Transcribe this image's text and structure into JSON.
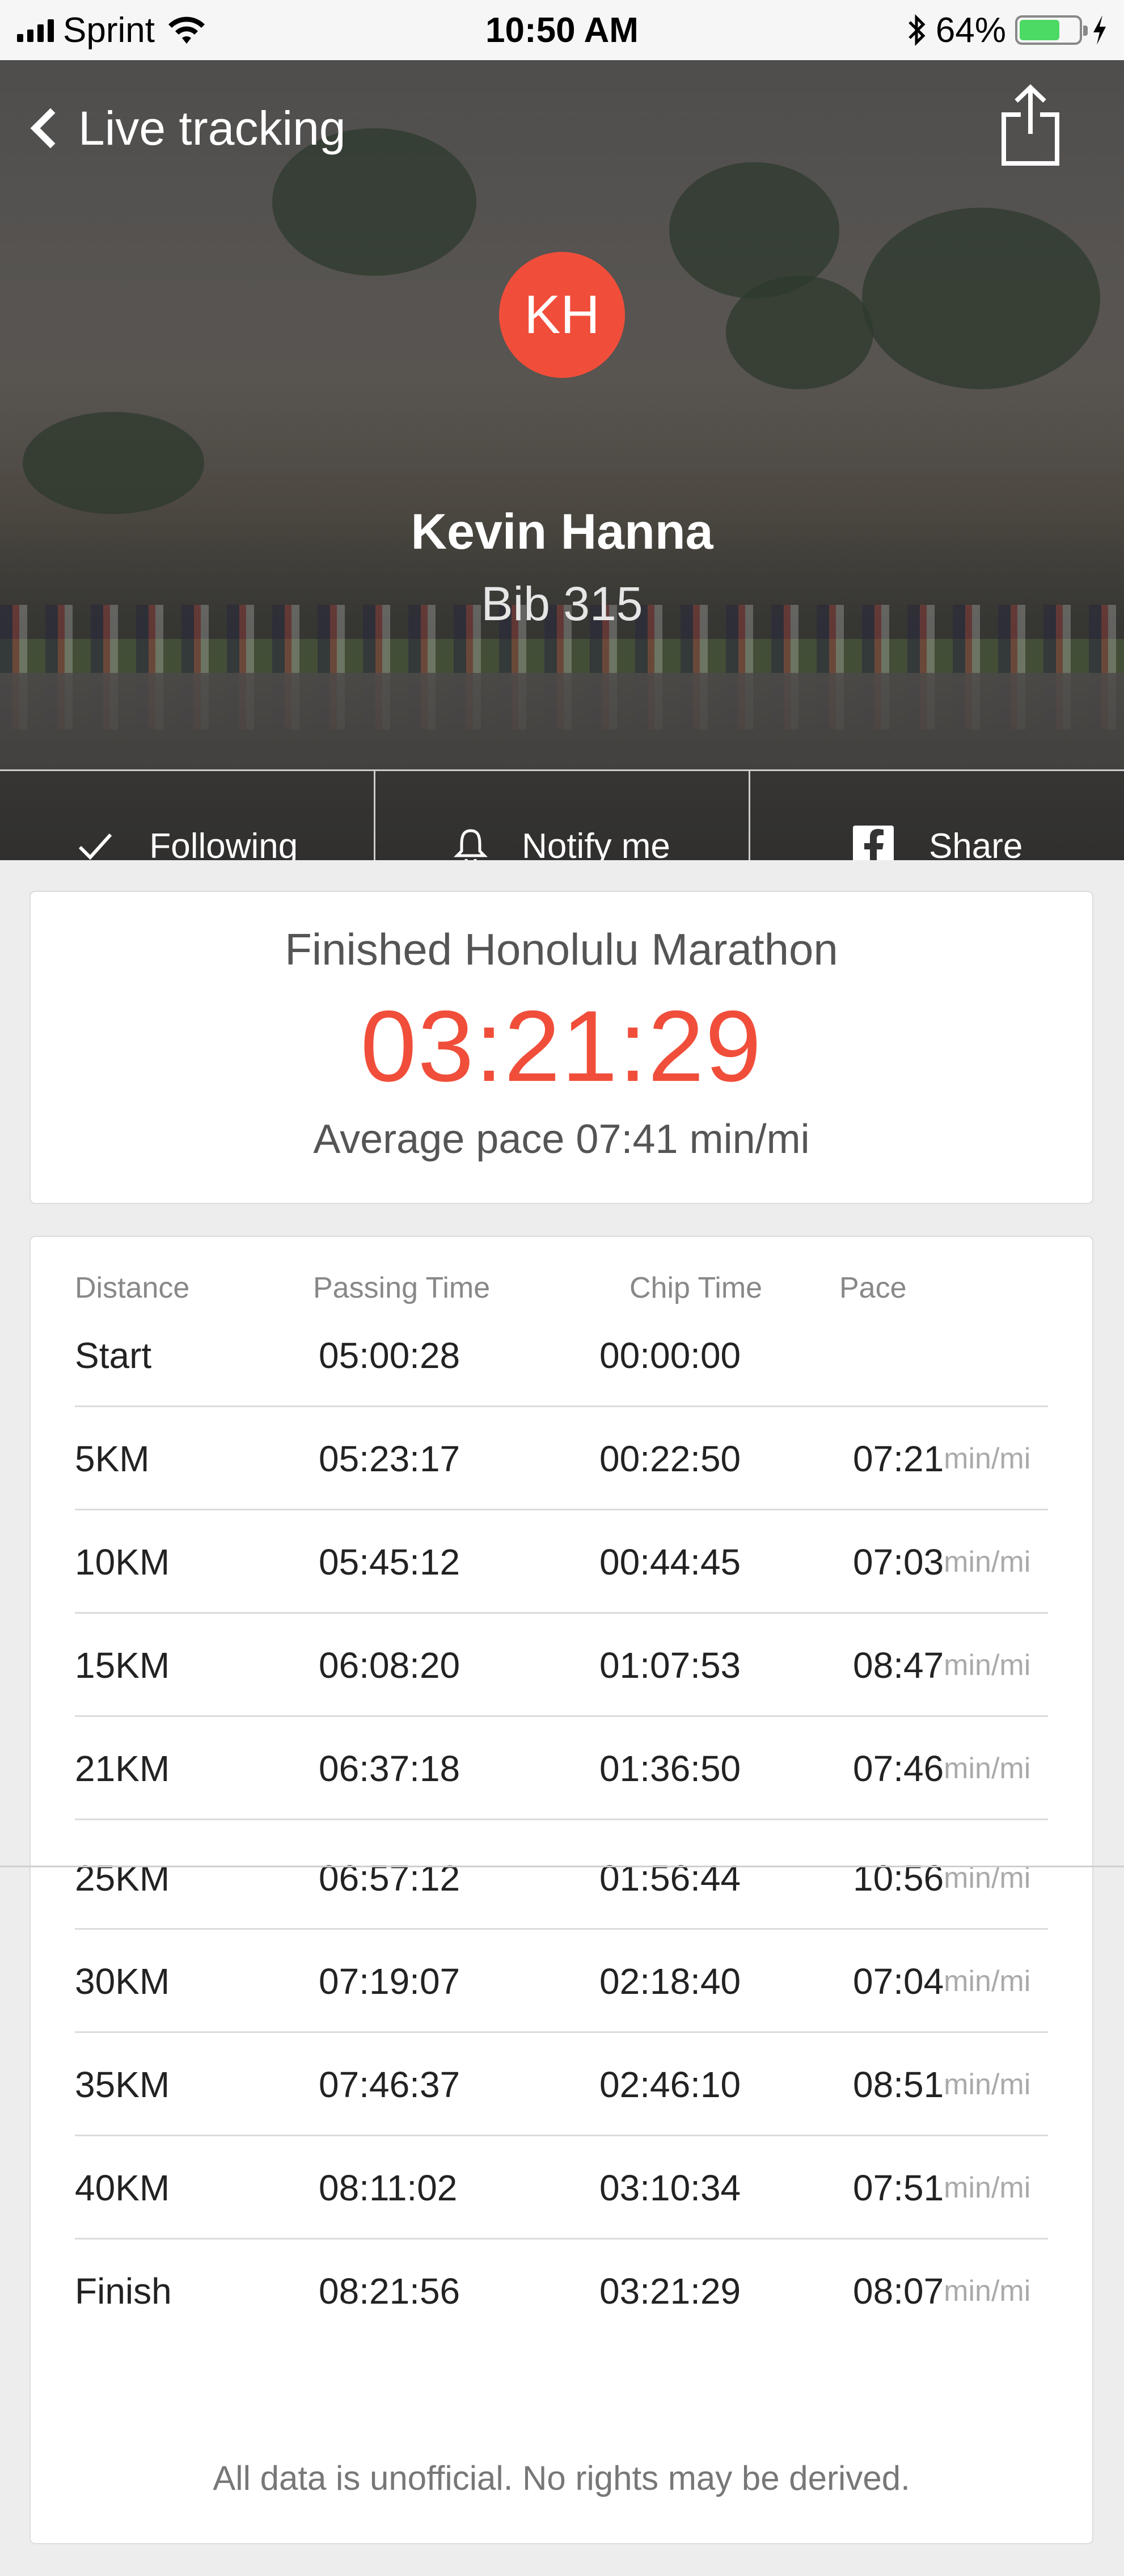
{
  "status_bar": {
    "carrier": "Sprint",
    "time": "10:50 AM",
    "battery": "64%",
    "battery_color": "#4cd964"
  },
  "nav": {
    "back_label": "Live tracking",
    "share_icon": "share-icon"
  },
  "runner": {
    "initials": "KH",
    "name": "Kevin Hanna",
    "bib": "Bib 315",
    "avatar_color": "#f04e3a"
  },
  "actions": [
    {
      "label": "Following",
      "icon": "check-icon"
    },
    {
      "label": "Notify me",
      "icon": "bell-icon"
    },
    {
      "label": "Share",
      "icon": "facebook-icon"
    }
  ],
  "summary": {
    "event": "Finished Honolulu Marathon",
    "finish_time": "03:21:29",
    "average_pace": "Average pace 07:41 min/mi",
    "accent_color": "#f04e3a"
  },
  "splits": {
    "headers": [
      "Distance",
      "Passing Time",
      "Chip Time",
      "Pace"
    ],
    "unit": "min/mi",
    "rows": [
      {
        "distance": "Start",
        "passing": "05:00:28",
        "chip": "00:00:00",
        "pace": ""
      },
      {
        "distance": "5KM",
        "passing": "05:23:17",
        "chip": "00:22:50",
        "pace": "07:21"
      },
      {
        "distance": "10KM",
        "passing": "05:45:12",
        "chip": "00:44:45",
        "pace": "07:03"
      },
      {
        "distance": "15KM",
        "passing": "06:08:20",
        "chip": "01:07:53",
        "pace": "08:47"
      },
      {
        "distance": "21KM",
        "passing": "06:37:18",
        "chip": "01:36:50",
        "pace": "07:46"
      },
      {
        "distance": "25KM",
        "passing": "06:57:12",
        "chip": "01:56:44",
        "pace": "10:56"
      },
      {
        "distance": "30KM",
        "passing": "07:19:07",
        "chip": "02:18:40",
        "pace": "07:04"
      },
      {
        "distance": "35KM",
        "passing": "07:46:37",
        "chip": "02:46:10",
        "pace": "08:51"
      },
      {
        "distance": "40KM",
        "passing": "08:11:02",
        "chip": "03:10:34",
        "pace": "07:51"
      },
      {
        "distance": "Finish",
        "passing": "08:21:56",
        "chip": "03:21:29",
        "pace": "08:07"
      }
    ],
    "footnote": "All data is unofficial. No rights may be derived."
  }
}
